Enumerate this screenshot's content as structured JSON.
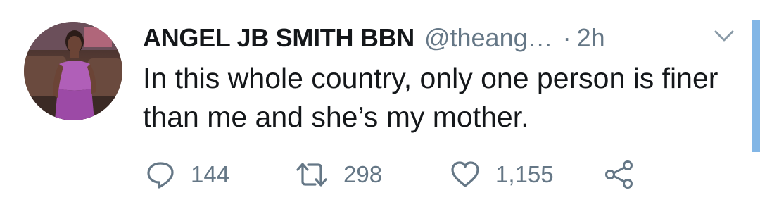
{
  "tweet": {
    "author_name": "ANGEL JB SMITH BBN",
    "handle": "@theang…",
    "separator": "·",
    "time": "2h",
    "text": "In this whole country, only one person is finer than me and she’s my mother.",
    "replies": "144",
    "retweets": "298",
    "likes": "1,155"
  },
  "icons": {
    "menu": "chevron-down-icon",
    "reply": "reply-icon",
    "retweet": "retweet-icon",
    "like": "heart-icon",
    "share": "share-icon"
  },
  "colors": {
    "text_primary": "#14171a",
    "text_secondary": "#657786",
    "edge_accent": "#82b6e6"
  }
}
